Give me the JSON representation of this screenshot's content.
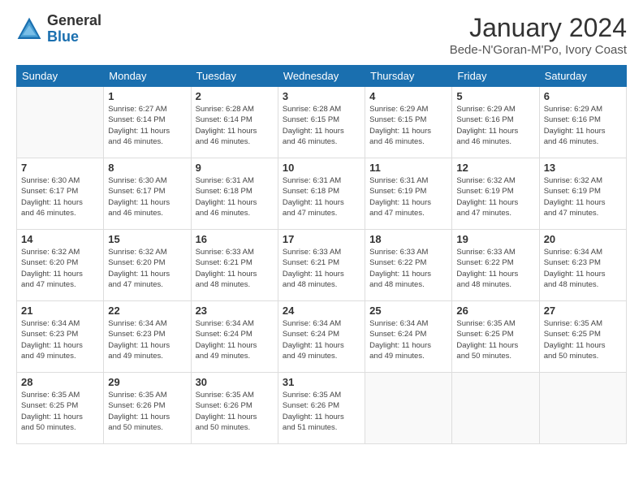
{
  "header": {
    "logo_general": "General",
    "logo_blue": "Blue",
    "title": "January 2024",
    "location": "Bede-N'Goran-M'Po, Ivory Coast"
  },
  "days_of_week": [
    "Sunday",
    "Monday",
    "Tuesday",
    "Wednesday",
    "Thursday",
    "Friday",
    "Saturday"
  ],
  "weeks": [
    [
      {
        "day": "",
        "info": ""
      },
      {
        "day": "1",
        "info": "Sunrise: 6:27 AM\nSunset: 6:14 PM\nDaylight: 11 hours\nand 46 minutes."
      },
      {
        "day": "2",
        "info": "Sunrise: 6:28 AM\nSunset: 6:14 PM\nDaylight: 11 hours\nand 46 minutes."
      },
      {
        "day": "3",
        "info": "Sunrise: 6:28 AM\nSunset: 6:15 PM\nDaylight: 11 hours\nand 46 minutes."
      },
      {
        "day": "4",
        "info": "Sunrise: 6:29 AM\nSunset: 6:15 PM\nDaylight: 11 hours\nand 46 minutes."
      },
      {
        "day": "5",
        "info": "Sunrise: 6:29 AM\nSunset: 6:16 PM\nDaylight: 11 hours\nand 46 minutes."
      },
      {
        "day": "6",
        "info": "Sunrise: 6:29 AM\nSunset: 6:16 PM\nDaylight: 11 hours\nand 46 minutes."
      }
    ],
    [
      {
        "day": "7",
        "info": "Sunrise: 6:30 AM\nSunset: 6:17 PM\nDaylight: 11 hours\nand 46 minutes."
      },
      {
        "day": "8",
        "info": "Sunrise: 6:30 AM\nSunset: 6:17 PM\nDaylight: 11 hours\nand 46 minutes."
      },
      {
        "day": "9",
        "info": "Sunrise: 6:31 AM\nSunset: 6:18 PM\nDaylight: 11 hours\nand 46 minutes."
      },
      {
        "day": "10",
        "info": "Sunrise: 6:31 AM\nSunset: 6:18 PM\nDaylight: 11 hours\nand 47 minutes."
      },
      {
        "day": "11",
        "info": "Sunrise: 6:31 AM\nSunset: 6:19 PM\nDaylight: 11 hours\nand 47 minutes."
      },
      {
        "day": "12",
        "info": "Sunrise: 6:32 AM\nSunset: 6:19 PM\nDaylight: 11 hours\nand 47 minutes."
      },
      {
        "day": "13",
        "info": "Sunrise: 6:32 AM\nSunset: 6:19 PM\nDaylight: 11 hours\nand 47 minutes."
      }
    ],
    [
      {
        "day": "14",
        "info": "Sunrise: 6:32 AM\nSunset: 6:20 PM\nDaylight: 11 hours\nand 47 minutes."
      },
      {
        "day": "15",
        "info": "Sunrise: 6:32 AM\nSunset: 6:20 PM\nDaylight: 11 hours\nand 47 minutes."
      },
      {
        "day": "16",
        "info": "Sunrise: 6:33 AM\nSunset: 6:21 PM\nDaylight: 11 hours\nand 48 minutes."
      },
      {
        "day": "17",
        "info": "Sunrise: 6:33 AM\nSunset: 6:21 PM\nDaylight: 11 hours\nand 48 minutes."
      },
      {
        "day": "18",
        "info": "Sunrise: 6:33 AM\nSunset: 6:22 PM\nDaylight: 11 hours\nand 48 minutes."
      },
      {
        "day": "19",
        "info": "Sunrise: 6:33 AM\nSunset: 6:22 PM\nDaylight: 11 hours\nand 48 minutes."
      },
      {
        "day": "20",
        "info": "Sunrise: 6:34 AM\nSunset: 6:23 PM\nDaylight: 11 hours\nand 48 minutes."
      }
    ],
    [
      {
        "day": "21",
        "info": "Sunrise: 6:34 AM\nSunset: 6:23 PM\nDaylight: 11 hours\nand 49 minutes."
      },
      {
        "day": "22",
        "info": "Sunrise: 6:34 AM\nSunset: 6:23 PM\nDaylight: 11 hours\nand 49 minutes."
      },
      {
        "day": "23",
        "info": "Sunrise: 6:34 AM\nSunset: 6:24 PM\nDaylight: 11 hours\nand 49 minutes."
      },
      {
        "day": "24",
        "info": "Sunrise: 6:34 AM\nSunset: 6:24 PM\nDaylight: 11 hours\nand 49 minutes."
      },
      {
        "day": "25",
        "info": "Sunrise: 6:34 AM\nSunset: 6:24 PM\nDaylight: 11 hours\nand 49 minutes."
      },
      {
        "day": "26",
        "info": "Sunrise: 6:35 AM\nSunset: 6:25 PM\nDaylight: 11 hours\nand 50 minutes."
      },
      {
        "day": "27",
        "info": "Sunrise: 6:35 AM\nSunset: 6:25 PM\nDaylight: 11 hours\nand 50 minutes."
      }
    ],
    [
      {
        "day": "28",
        "info": "Sunrise: 6:35 AM\nSunset: 6:25 PM\nDaylight: 11 hours\nand 50 minutes."
      },
      {
        "day": "29",
        "info": "Sunrise: 6:35 AM\nSunset: 6:26 PM\nDaylight: 11 hours\nand 50 minutes."
      },
      {
        "day": "30",
        "info": "Sunrise: 6:35 AM\nSunset: 6:26 PM\nDaylight: 11 hours\nand 50 minutes."
      },
      {
        "day": "31",
        "info": "Sunrise: 6:35 AM\nSunset: 6:26 PM\nDaylight: 11 hours\nand 51 minutes."
      },
      {
        "day": "",
        "info": ""
      },
      {
        "day": "",
        "info": ""
      },
      {
        "day": "",
        "info": ""
      }
    ]
  ]
}
